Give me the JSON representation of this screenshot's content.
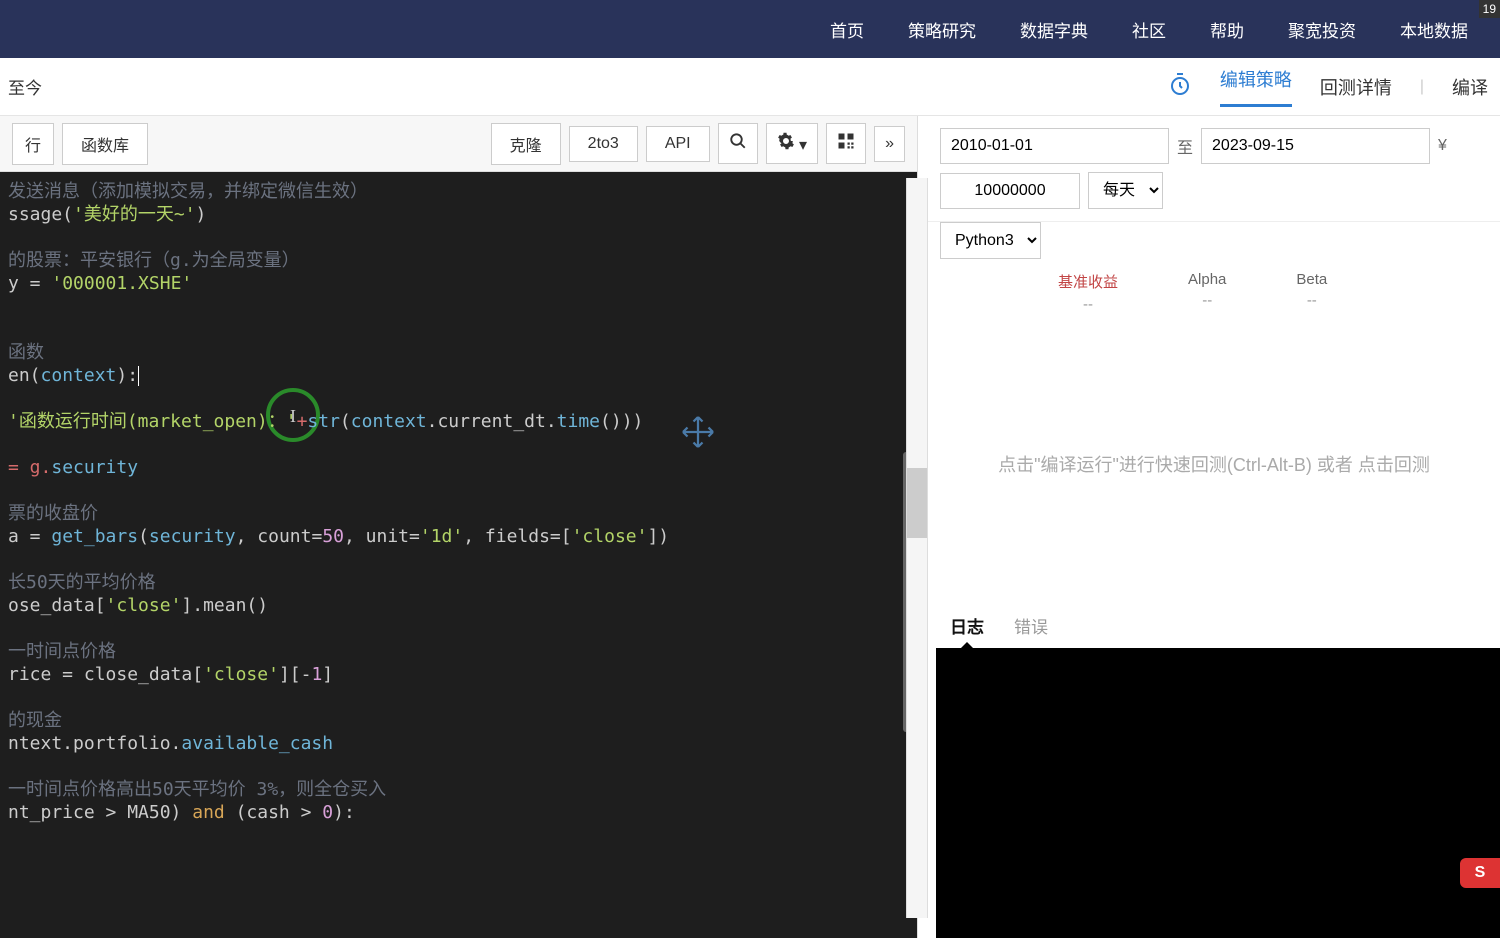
{
  "topnav": {
    "items": [
      "首页",
      "策略研究",
      "数据字典",
      "社区",
      "帮助",
      "聚宽投资",
      "本地数据"
    ],
    "badge": "19"
  },
  "subbar": {
    "title_suffix": "至今",
    "tabs": {
      "edit": "编辑策略",
      "detail": "回测详情",
      "compile": "编译"
    }
  },
  "toolbar": {
    "left": {
      "run": "行",
      "funclib": "函数库"
    },
    "right": {
      "clone": "克隆",
      "to3": "2to3",
      "api": "API",
      "more": "»"
    }
  },
  "code": {
    "c1": "发送消息（添加模拟交易，并绑定微信生效）",
    "l1a": "ssage(",
    "l1b": "'美好的一天~'",
    "l1c": ")",
    "c2": "的股票：平安银行（g.为全局变量）",
    "l2a": "y = ",
    "l2b": "'000001.XSHE'",
    "c3": "函数",
    "l3a": "en(",
    "l3b": "context",
    "l3c": "):",
    "l4a": "'函数运行时间(market_open)：'",
    "l4b": "+",
    "l4c": "str",
    "l4d": "(",
    "l4e": "context",
    "l4f": ".current_dt.",
    "l4g": "time",
    "l4h": "()))",
    "l5a": "= g.",
    "l5b": "security",
    "c4": "票的收盘价",
    "l6a": "a = ",
    "l6b": "get_bars",
    "l6c": "(",
    "l6d": "security",
    "l6e": ", count=",
    "l6f": "50",
    "l6g": ", unit=",
    "l6h": "'1d'",
    "l6i": ", fields=[",
    "l6j": "'close'",
    "l6k": "])",
    "c5": "长50天的平均价格",
    "l7a": "ose_data[",
    "l7b": "'close'",
    "l7c": "].mean()",
    "c6": "一时间点价格",
    "l8a": "rice = close_data[",
    "l8b": "'close'",
    "l8c": "][-",
    "l8d": "1",
    "l8e": "]",
    "c7": "的现金",
    "l9a": "ntext.portfolio.",
    "l9b": "available_cash",
    "c8": "一时间点价格高出50天平均价 3%，则全仓买入",
    "l10a": "nt_price > MA50) ",
    "l10b": "and",
    "l10c": " (cash > ",
    "l10d": "0",
    "l10e": "):"
  },
  "backtest": {
    "date_from": "2010-01-01",
    "to_label": "至",
    "date_to": "2023-09-15",
    "currency": "¥",
    "amount": "10000000",
    "freq": "每天",
    "lang": "Python3",
    "metrics": {
      "bench": {
        "label": "基准收益",
        "value": "--"
      },
      "alpha": {
        "label": "Alpha",
        "value": "--"
      },
      "beta": {
        "label": "Beta",
        "value": "--"
      }
    },
    "hint": "点击\"编译运行\"进行快速回测(Ctrl-Alt-B) 或者 点击回测"
  },
  "logs": {
    "tab_log": "日志",
    "tab_err": "错误"
  },
  "ime": "S"
}
